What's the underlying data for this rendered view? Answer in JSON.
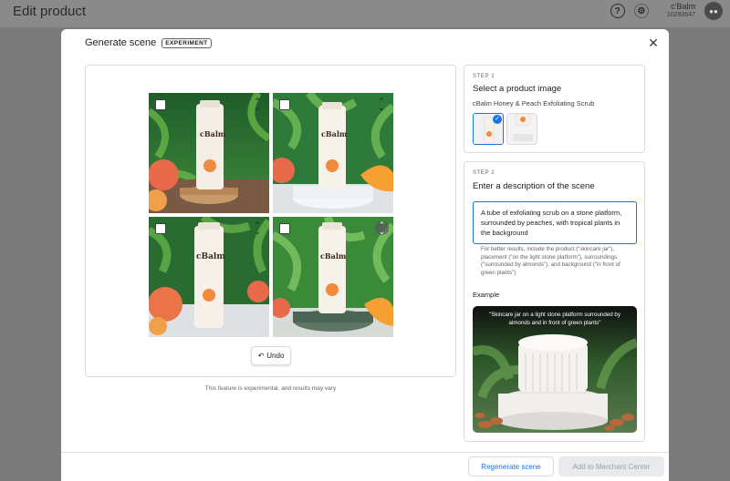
{
  "app": {
    "title": "Edit product",
    "help_icon": "help-circle-icon",
    "settings_icon": "gear-icon",
    "account_name": "c'Balm",
    "account_id": "10293647"
  },
  "modal": {
    "title": "Generate scene",
    "badge": "EXPERIMENT",
    "close_icon": "close-icon",
    "undo_label": "Undo",
    "disclaimer": "This feature is experimental, and results may vary",
    "images": [
      {
        "brand": "cBalm",
        "stand": "wood"
      },
      {
        "brand": "cBalm",
        "stand": "white-pedestal"
      },
      {
        "brand": "cBalm",
        "stand": "none"
      },
      {
        "brand": "cBalm",
        "stand": "green-stone"
      }
    ]
  },
  "step1": {
    "label": "STEP 1",
    "title": "Select a product image",
    "product_name": "cBalm Honey & Peach Exfoliating Scrub"
  },
  "step2": {
    "label": "STEP 2",
    "title": "Enter a description of the scene",
    "description": "A tube of exfoliating scrub on a stone platform, surrounded by peaches, with tropical plants in the background",
    "hint": "For better results, include the product (\"skincare jar\"), placement (\"on the light stone platform\"), surroundings (\"surrounded by almonds\"), and background (\"in front of green plants\")",
    "example_label": "Example",
    "example_caption": "\"Skincare jar on a light stone platform surrounded by almonds and in front of green plants\""
  },
  "footer": {
    "regenerate_label": "Regenerate scene",
    "add_label": "Add to Merchant Center"
  },
  "colors": {
    "accent": "#1a73e8",
    "border": "#dadce0"
  }
}
